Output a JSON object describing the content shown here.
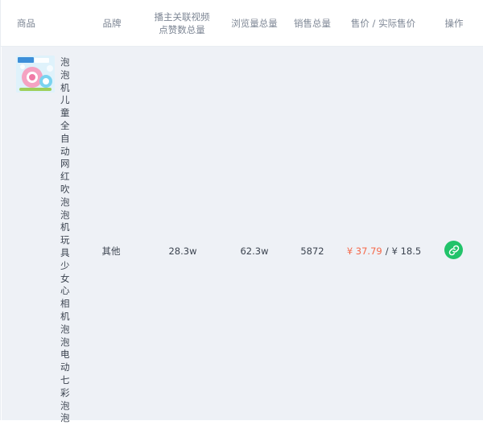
{
  "columns": {
    "product": "商品",
    "brand": "品牌",
    "likes_line1": "播主关联视频",
    "likes_line2": "点赞数总量",
    "views": "浏览量总量",
    "sales": "销售总量",
    "price": "售价 / 实际售价",
    "action": "操作"
  },
  "row": {
    "product_title": "泡泡机儿童全自动网红吹泡泡机玩具少女心相机泡泡电动七彩泡泡",
    "thumb_label": "泡泡 泡泡",
    "brand": "其他",
    "likes": "28.3w",
    "views": "62.3w",
    "sales": "5872",
    "price_original": "¥ 37.79",
    "price_separator": "/",
    "price_actual": "¥ 18.5",
    "action_icon": "link-icon"
  },
  "colors": {
    "accent_green": "#22c36a",
    "price_red": "#f5694a",
    "row_bg": "#eef1f6"
  }
}
